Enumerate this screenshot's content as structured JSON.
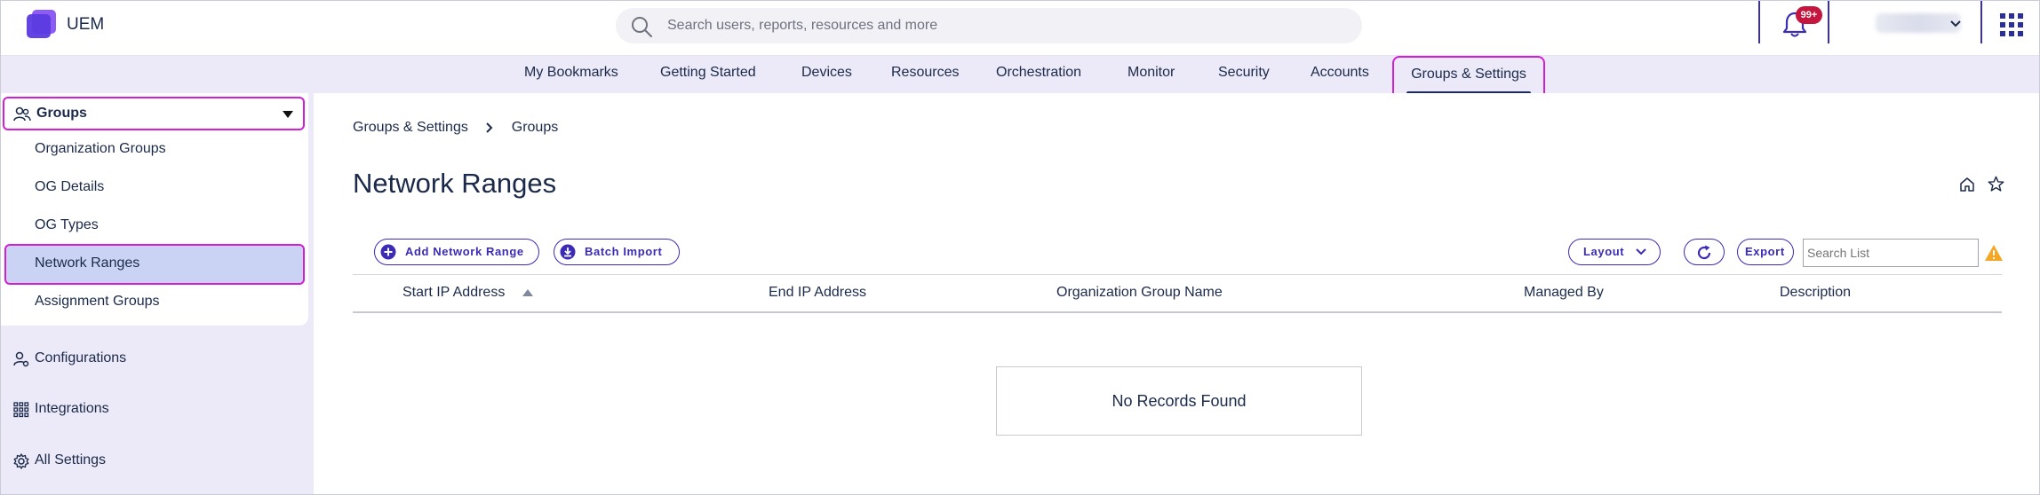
{
  "header": {
    "app_name": "UEM",
    "search_placeholder": "Search users, reports, resources and more",
    "notifications_badge": "99+"
  },
  "nav": {
    "items": [
      {
        "label": "My Bookmarks"
      },
      {
        "label": "Getting Started"
      },
      {
        "label": "Devices"
      },
      {
        "label": "Resources"
      },
      {
        "label": "Orchestration"
      },
      {
        "label": "Monitor"
      },
      {
        "label": "Security"
      },
      {
        "label": "Accounts"
      },
      {
        "label": "Groups & Settings",
        "active": true
      }
    ]
  },
  "sidebar": {
    "groups_label": "Groups",
    "group_items": [
      {
        "label": "Organization Groups"
      },
      {
        "label": "OG Details"
      },
      {
        "label": "OG Types"
      },
      {
        "label": "Network Ranges",
        "selected": true
      },
      {
        "label": "Assignment Groups"
      }
    ],
    "sections": [
      {
        "label": "Configurations",
        "icon": "person-gear-icon"
      },
      {
        "label": "Integrations",
        "icon": "grid-dots-icon"
      },
      {
        "label": "All Settings",
        "icon": "gear-icon"
      }
    ]
  },
  "content": {
    "breadcrumb": [
      "Groups & Settings",
      "Groups"
    ],
    "title": "Network Ranges",
    "toolbar": {
      "add_label": "Add Network Range",
      "import_label": "Batch Import",
      "layout_label": "Layout",
      "export_label": "Export",
      "search_placeholder": "Search List"
    },
    "table": {
      "columns": [
        "Start IP Address",
        "End IP Address",
        "Organization Group Name",
        "Managed By",
        "Description"
      ],
      "sort_column": "Start IP Address",
      "sort_direction": "ascending",
      "empty_message": "No Records Found"
    }
  },
  "colors": {
    "accent": "#3b2bb5",
    "highlight_border": "#d11fd6",
    "nav_bg": "#ece9f8",
    "selected_bg": "#cbd3f4",
    "badge": "#c4163e",
    "warning": "#f5a623"
  }
}
